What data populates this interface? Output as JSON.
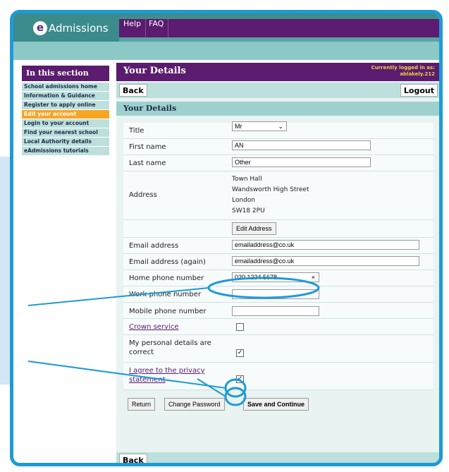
{
  "brand": {
    "logo_letter": "e",
    "logo_text": "Admissions"
  },
  "topnav": [
    "Help",
    "FAQ"
  ],
  "sidebar": {
    "heading": "In this section",
    "items": [
      "School admissions home",
      "Information & Guidance",
      "Register to apply online",
      "Edit your account",
      "Login to your account",
      "Find your nearest school",
      "Local Authority details",
      "eAdmissions tutorials"
    ]
  },
  "header": {
    "title": "Your Details",
    "logged_in_label": "Currently logged in as:",
    "username": "ablakely.212"
  },
  "toolbar": {
    "back": "Back",
    "logout": "Logout"
  },
  "section_title": "Your Details",
  "form": {
    "title_label": "Title",
    "title_value": "Mr",
    "first_name_label": "First name",
    "first_name_value": "AN",
    "last_name_label": "Last name",
    "last_name_value": "Other",
    "address_label": "Address",
    "address_lines": [
      "Town Hall",
      "Wandsworth High Street",
      "London",
      "SW18 2PU"
    ],
    "edit_address": "Edit Address",
    "email_label": "Email address",
    "email_value": "emailaddress@co.uk",
    "email2_label": "Email address (again)",
    "email2_value": "emailaddress@co.uk",
    "home_phone_label": "Home phone number",
    "home_phone_value": "020 1234 5678",
    "work_phone_label": "Work phone number",
    "work_phone_value": "",
    "mobile_phone_label": "Mobile phone number",
    "mobile_phone_value": "",
    "crown_label": "Crown service",
    "crown_checked": false,
    "correct_label": "My personal details are correct",
    "correct_checked": true,
    "privacy_label": "I agree to the privacy statement",
    "privacy_checked": true,
    "clear_symbol": "×",
    "check_symbol": "✓"
  },
  "actions": {
    "return": "Return",
    "change_password": "Change Password",
    "save": "Save and Continue"
  },
  "bottom": {
    "back": "Back"
  },
  "colors": {
    "frame": "#1f9ad6",
    "purple": "#5b1b6e",
    "teal": "#bde0dc",
    "active": "#f5a623"
  }
}
